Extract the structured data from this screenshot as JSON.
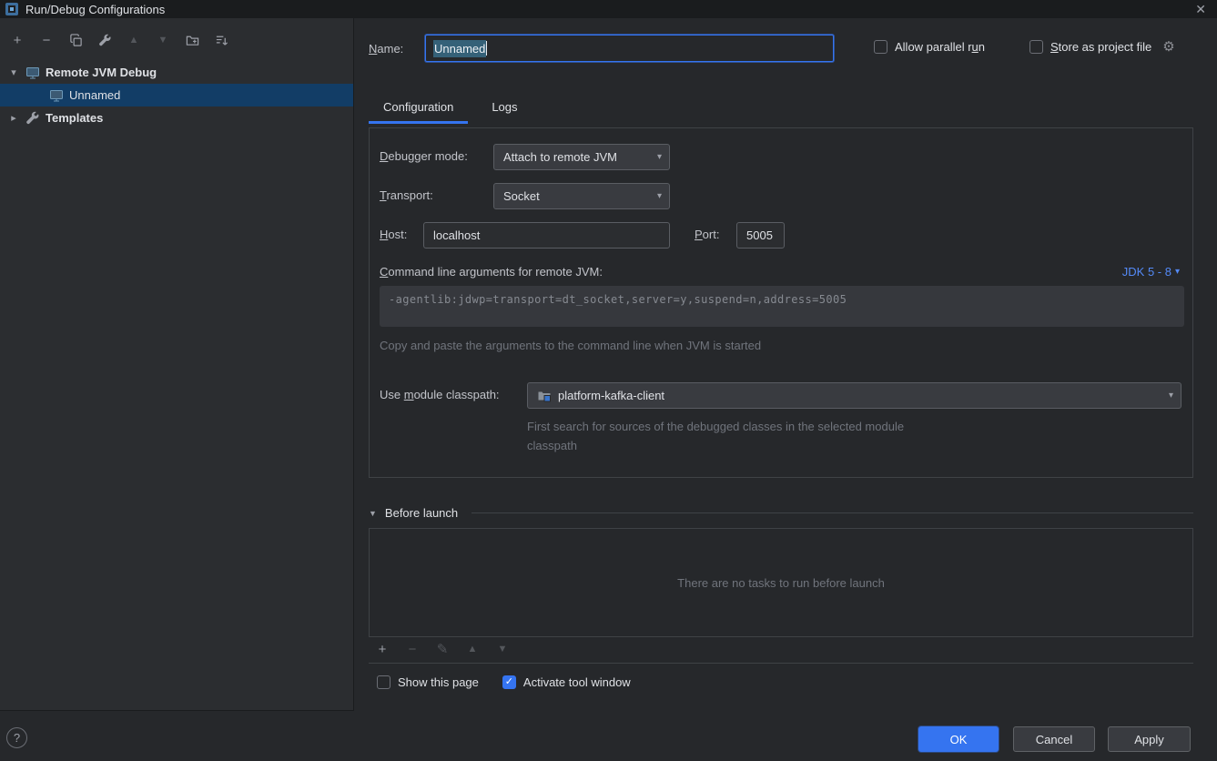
{
  "titlebar": {
    "title": "Run/Debug Configurations",
    "close": "✕"
  },
  "sidebar": {
    "tree": {
      "group_remote_jvm_debug": "Remote JVM Debug",
      "item_unnamed": "Unnamed",
      "group_templates": "Templates"
    }
  },
  "header": {
    "name_label": "Name:",
    "name_value": "Unnamed",
    "allow_parallel_run_label": "Allow parallel run",
    "store_as_project_file_label": "Store as project file"
  },
  "tabs": {
    "configuration": "Configuration",
    "logs": "Logs"
  },
  "config": {
    "debugger_mode_label": "Debugger mode:",
    "debugger_mode_value": "Attach to remote JVM",
    "transport_label": "Transport:",
    "transport_value": "Socket",
    "host_label": "Host:",
    "host_value": "localhost",
    "port_label": "Port:",
    "port_value": "5005",
    "cmdline_label": "Command line arguments for remote JVM:",
    "jdk_range": "JDK 5 - 8",
    "cmdline_value": "-agentlib:jdwp=transport=dt_socket,server=y,suspend=n,address=5005",
    "cmdline_hint": "Copy and paste the arguments to the command line when JVM is started",
    "module_label": "Use module classpath:",
    "module_value": "platform-kafka-client",
    "module_hint": "First search for sources of the debugged classes in the selected module classpath"
  },
  "before_launch": {
    "title": "Before launch",
    "empty_text": "There are no tasks to run before launch"
  },
  "options": {
    "show_this_page": "Show this page",
    "activate_tool_window": "Activate tool window"
  },
  "footer": {
    "ok": "OK",
    "cancel": "Cancel",
    "apply": "Apply",
    "help": "?"
  },
  "icons": {
    "add": "+",
    "remove": "−",
    "move_up": "▲",
    "move_down": "▼",
    "edit_pencil": "✎",
    "gear": "⚙",
    "check": "✓",
    "chevron_expanded": "▾",
    "chevron_collapsed": "▸",
    "combo_arrow": "▾",
    "section_arrow": "▼"
  },
  "colors": {
    "accent": "#3574F0",
    "link": "#548AF7",
    "tree_selection": "#123D66"
  }
}
